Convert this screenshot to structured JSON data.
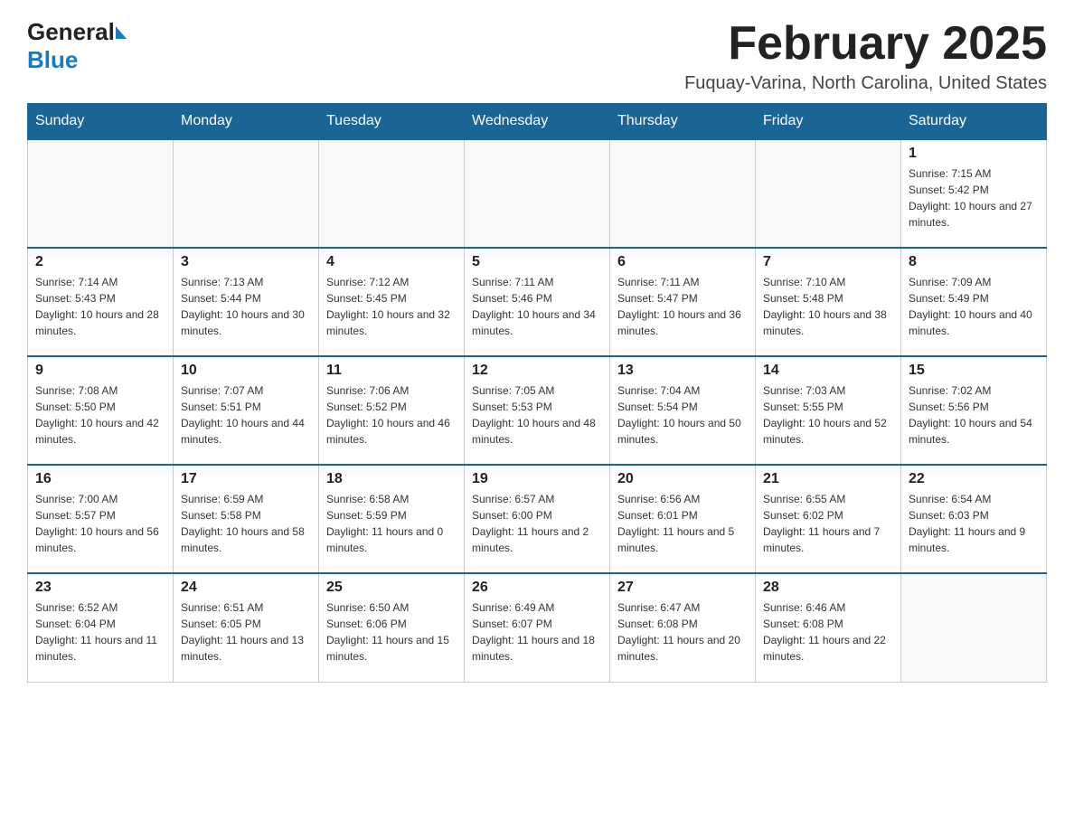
{
  "header": {
    "logo_general": "General",
    "logo_blue": "Blue",
    "month_title": "February 2025",
    "location": "Fuquay-Varina, North Carolina, United States"
  },
  "days_of_week": [
    "Sunday",
    "Monday",
    "Tuesday",
    "Wednesday",
    "Thursday",
    "Friday",
    "Saturday"
  ],
  "weeks": [
    [
      {
        "day": "",
        "info": ""
      },
      {
        "day": "",
        "info": ""
      },
      {
        "day": "",
        "info": ""
      },
      {
        "day": "",
        "info": ""
      },
      {
        "day": "",
        "info": ""
      },
      {
        "day": "",
        "info": ""
      },
      {
        "day": "1",
        "info": "Sunrise: 7:15 AM\nSunset: 5:42 PM\nDaylight: 10 hours and 27 minutes."
      }
    ],
    [
      {
        "day": "2",
        "info": "Sunrise: 7:14 AM\nSunset: 5:43 PM\nDaylight: 10 hours and 28 minutes."
      },
      {
        "day": "3",
        "info": "Sunrise: 7:13 AM\nSunset: 5:44 PM\nDaylight: 10 hours and 30 minutes."
      },
      {
        "day": "4",
        "info": "Sunrise: 7:12 AM\nSunset: 5:45 PM\nDaylight: 10 hours and 32 minutes."
      },
      {
        "day": "5",
        "info": "Sunrise: 7:11 AM\nSunset: 5:46 PM\nDaylight: 10 hours and 34 minutes."
      },
      {
        "day": "6",
        "info": "Sunrise: 7:11 AM\nSunset: 5:47 PM\nDaylight: 10 hours and 36 minutes."
      },
      {
        "day": "7",
        "info": "Sunrise: 7:10 AM\nSunset: 5:48 PM\nDaylight: 10 hours and 38 minutes."
      },
      {
        "day": "8",
        "info": "Sunrise: 7:09 AM\nSunset: 5:49 PM\nDaylight: 10 hours and 40 minutes."
      }
    ],
    [
      {
        "day": "9",
        "info": "Sunrise: 7:08 AM\nSunset: 5:50 PM\nDaylight: 10 hours and 42 minutes."
      },
      {
        "day": "10",
        "info": "Sunrise: 7:07 AM\nSunset: 5:51 PM\nDaylight: 10 hours and 44 minutes."
      },
      {
        "day": "11",
        "info": "Sunrise: 7:06 AM\nSunset: 5:52 PM\nDaylight: 10 hours and 46 minutes."
      },
      {
        "day": "12",
        "info": "Sunrise: 7:05 AM\nSunset: 5:53 PM\nDaylight: 10 hours and 48 minutes."
      },
      {
        "day": "13",
        "info": "Sunrise: 7:04 AM\nSunset: 5:54 PM\nDaylight: 10 hours and 50 minutes."
      },
      {
        "day": "14",
        "info": "Sunrise: 7:03 AM\nSunset: 5:55 PM\nDaylight: 10 hours and 52 minutes."
      },
      {
        "day": "15",
        "info": "Sunrise: 7:02 AM\nSunset: 5:56 PM\nDaylight: 10 hours and 54 minutes."
      }
    ],
    [
      {
        "day": "16",
        "info": "Sunrise: 7:00 AM\nSunset: 5:57 PM\nDaylight: 10 hours and 56 minutes."
      },
      {
        "day": "17",
        "info": "Sunrise: 6:59 AM\nSunset: 5:58 PM\nDaylight: 10 hours and 58 minutes."
      },
      {
        "day": "18",
        "info": "Sunrise: 6:58 AM\nSunset: 5:59 PM\nDaylight: 11 hours and 0 minutes."
      },
      {
        "day": "19",
        "info": "Sunrise: 6:57 AM\nSunset: 6:00 PM\nDaylight: 11 hours and 2 minutes."
      },
      {
        "day": "20",
        "info": "Sunrise: 6:56 AM\nSunset: 6:01 PM\nDaylight: 11 hours and 5 minutes."
      },
      {
        "day": "21",
        "info": "Sunrise: 6:55 AM\nSunset: 6:02 PM\nDaylight: 11 hours and 7 minutes."
      },
      {
        "day": "22",
        "info": "Sunrise: 6:54 AM\nSunset: 6:03 PM\nDaylight: 11 hours and 9 minutes."
      }
    ],
    [
      {
        "day": "23",
        "info": "Sunrise: 6:52 AM\nSunset: 6:04 PM\nDaylight: 11 hours and 11 minutes."
      },
      {
        "day": "24",
        "info": "Sunrise: 6:51 AM\nSunset: 6:05 PM\nDaylight: 11 hours and 13 minutes."
      },
      {
        "day": "25",
        "info": "Sunrise: 6:50 AM\nSunset: 6:06 PM\nDaylight: 11 hours and 15 minutes."
      },
      {
        "day": "26",
        "info": "Sunrise: 6:49 AM\nSunset: 6:07 PM\nDaylight: 11 hours and 18 minutes."
      },
      {
        "day": "27",
        "info": "Sunrise: 6:47 AM\nSunset: 6:08 PM\nDaylight: 11 hours and 20 minutes."
      },
      {
        "day": "28",
        "info": "Sunrise: 6:46 AM\nSunset: 6:08 PM\nDaylight: 11 hours and 22 minutes."
      },
      {
        "day": "",
        "info": ""
      }
    ]
  ]
}
